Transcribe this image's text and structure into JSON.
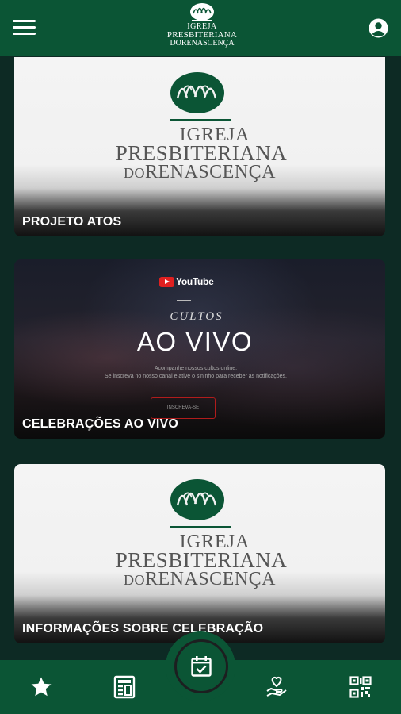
{
  "header": {
    "brand_line1": "IGREJA",
    "brand_line2": "PRESBITERIANA",
    "brand_line3": "DORENASCENÇA",
    "menu_icon": "hamburger-menu-icon",
    "profile_icon": "account-circle-icon"
  },
  "cards": [
    {
      "label": "PROJETO ATOS",
      "logo": {
        "line1": "IGREJA",
        "line2": "PRESBITERIANA",
        "line3_small": "DO",
        "line3": "RENASCENÇA"
      }
    },
    {
      "label": "CELEBRAÇÕES AO VIVO",
      "banner": {
        "platform": "YouTube",
        "kicker": "CULTOS",
        "headline": "AO VIVO",
        "sub1": "Acompanhe nossos cultos online.",
        "sub2": "Se inscreva no nosso canal e ative o sininho para receber as notificações.",
        "button": "INSCREVA-SE"
      }
    },
    {
      "label": "INFORMAÇÕES SOBRE CELEBRAÇÃO",
      "logo": {
        "line1": "IGREJA",
        "line2": "PRESBITERIANA",
        "line3_small": "DO",
        "line3": "RENASCENÇA"
      }
    }
  ],
  "bottom_nav": {
    "items": [
      "star-icon",
      "newspaper-icon",
      "calendar-check-icon",
      "hand-heart-icon",
      "qr-code-icon"
    ],
    "active": "calendar-check-icon"
  },
  "colors": {
    "brand_green": "#0b5535",
    "background": "#0d2a24",
    "logo_text_gray": "#555555",
    "youtube_red": "#e02020"
  }
}
